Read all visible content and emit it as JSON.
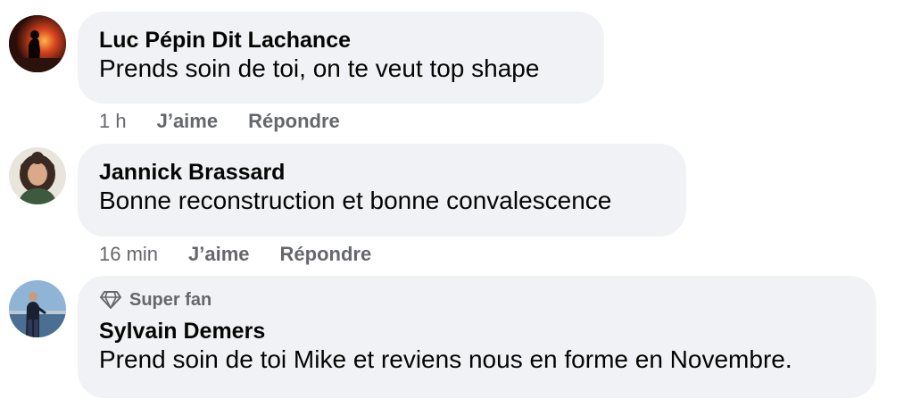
{
  "comments": [
    {
      "author": "Luc Pépin Dit Lachance",
      "text": "Prends soin de toi, on te veut top shape",
      "time": "1 h",
      "like_label": "J’aime",
      "reply_label": "Répondre",
      "avatar_icon": "bonfire-silhouette-avatar"
    },
    {
      "author": "Jannick Brassard",
      "text": "Bonne reconstruction et bonne convalescence",
      "time": "16 min",
      "like_label": "J’aime",
      "reply_label": "Répondre",
      "avatar_icon": "curly-hair-woman-avatar"
    },
    {
      "badge": "Super fan",
      "badge_icon": "diamond-icon",
      "author": "Sylvain Demers",
      "text": "Prend soin de toi Mike et reviens nous en forme en Novembre.",
      "avatar_icon": "man-by-water-avatar"
    }
  ],
  "colors": {
    "bubble": "#f0f2f5",
    "meta_text": "#65676b",
    "primary_text": "#050505"
  }
}
